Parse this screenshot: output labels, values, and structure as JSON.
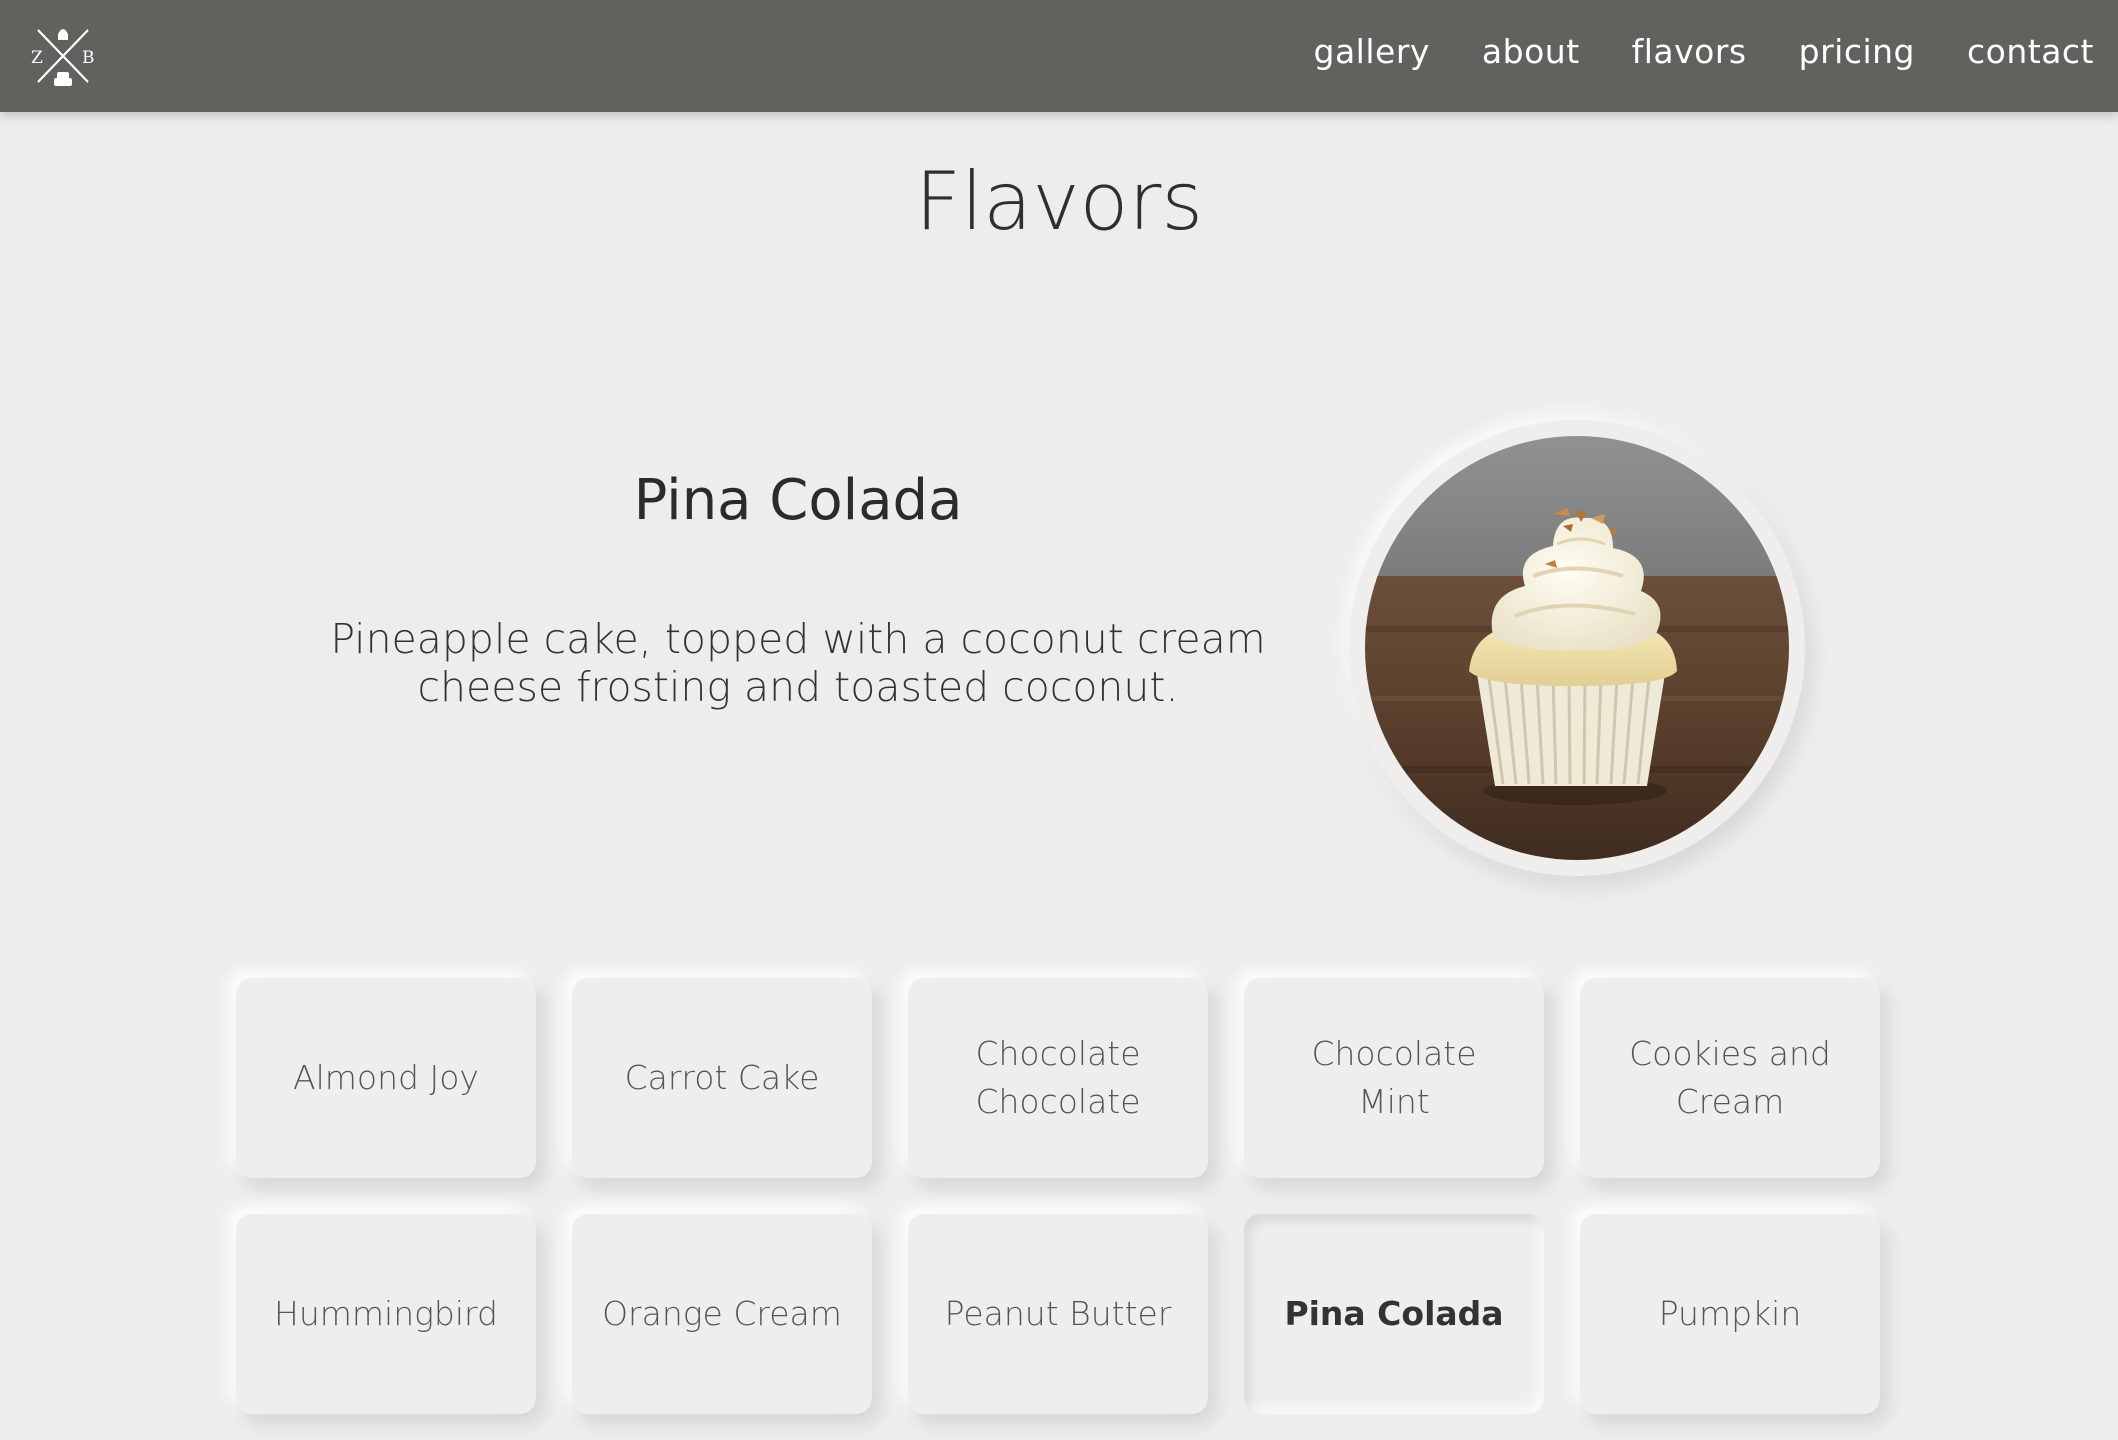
{
  "header": {
    "logo_letters": [
      "Z",
      "B"
    ],
    "nav": [
      "gallery",
      "about",
      "flavors",
      "pricing",
      "contact"
    ]
  },
  "page": {
    "title": "Flavors"
  },
  "featured": {
    "name": "Pina Colada",
    "description": "Pineapple cake, topped with a coconut cream cheese frosting and toasted coconut."
  },
  "flavors": [
    "Almond Joy",
    "Carrot Cake",
    "Chocolate Chocolate",
    "Chocolate Mint",
    "Cookies and Cream",
    "Hummingbird",
    "Orange Cream",
    "Peanut Butter",
    "Pina Colada",
    "Pumpkin"
  ],
  "selected_flavor": "Pina Colada",
  "colors": {
    "navbar": "#62615d",
    "background": "#eeedec"
  }
}
